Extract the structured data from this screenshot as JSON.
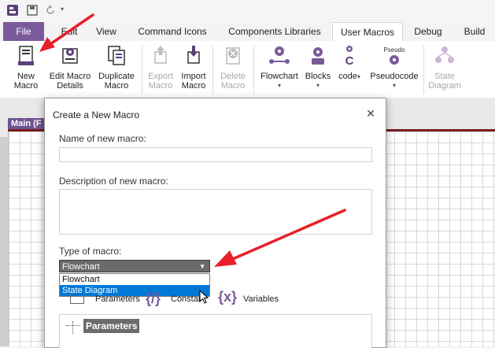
{
  "tabs": [
    "File",
    "Edit",
    "View",
    "Command Icons",
    "Components Libraries",
    "User Macros",
    "Debug",
    "Build"
  ],
  "ribbon": {
    "new_macro": "New\nMacro",
    "edit_macro": "Edit Macro\nDetails",
    "duplicate_macro": "Duplicate\nMacro",
    "export_macro": "Export\nMacro",
    "import_macro": "Import\nMacro",
    "delete_macro": "Delete\nMacro",
    "flowchart": "Flowchart",
    "blocks": "Blocks",
    "c_code_top": "C",
    "c_code": "code",
    "pseudocode": "Pseudocode",
    "pseudo_icon_text": "Pseudo",
    "state_diagram": "State\nDiagram"
  },
  "workspace": {
    "doc_tab": "Main (F"
  },
  "dialog": {
    "title": "Create a New Macro",
    "close": "✕",
    "name_label": "Name of new macro:",
    "name_value": "",
    "desc_label": "Description of new macro:",
    "desc_value": "",
    "type_label": "Type of macro:",
    "type_selected": "Flowchart",
    "options": [
      "Flowchart",
      "State Diagram"
    ],
    "selected_option_index": 1,
    "sub_parameters": "Parameters",
    "sub_constants": "Constar",
    "sub_variables": "Variables",
    "params_header": "Parameters"
  },
  "colors": {
    "accent": "#7b5a9c",
    "arrow": "#e8202a",
    "selection": "#0078d7"
  }
}
